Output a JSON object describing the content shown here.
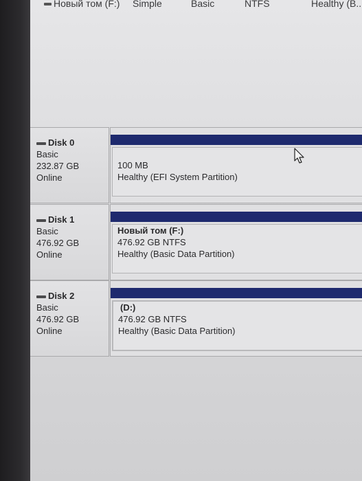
{
  "volume_row": {
    "name": "Новый том (F:)",
    "layout": "Simple",
    "type": "Basic",
    "file_system": "NTFS",
    "status": "Healthy (B..."
  },
  "disks": [
    {
      "title": "Disk 0",
      "type": "Basic",
      "size": "232.87 GB",
      "state": "Online",
      "partition": {
        "name": "",
        "size": "100 MB",
        "status": "Healthy (EFI System Partition)"
      }
    },
    {
      "title": "Disk 1",
      "type": "Basic",
      "size": "476.92 GB",
      "state": "Online",
      "partition": {
        "name": "Новый том  (F:)",
        "size": "476.92 GB NTFS",
        "status": "Healthy (Basic Data Partition)"
      }
    },
    {
      "title": "Disk 2",
      "type": "Basic",
      "size": "476.92 GB",
      "state": "Online",
      "partition": {
        "name": "(D:)",
        "size": "476.92 GB NTFS",
        "status": "Healthy (Basic Data Partition)"
      }
    }
  ],
  "colors": {
    "partition_header": "#1e2a6e",
    "background": "#d8d8da"
  },
  "icons": {
    "disk": "disk-drive-icon",
    "volume": "volume-icon",
    "pointer": "mouse-cursor-icon"
  }
}
